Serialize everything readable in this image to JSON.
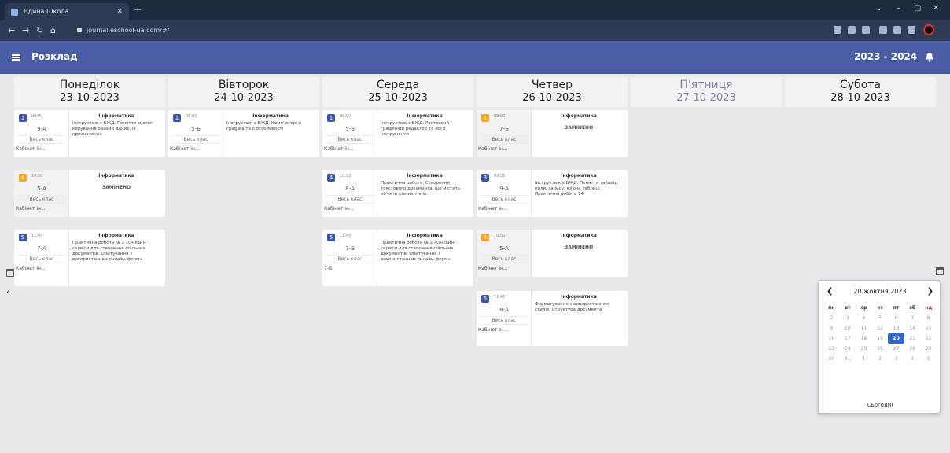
{
  "browser": {
    "tab_title": "Єдина Школа",
    "url": "journal.eschool-ua.com/#/",
    "window_controls": [
      "⌄",
      "–",
      "▢",
      "✕"
    ]
  },
  "app": {
    "title": "Розклад",
    "year": "2023 - 2024"
  },
  "days": [
    {
      "name": "Понеділок",
      "date": "23-10-2023"
    },
    {
      "name": "Вівторок",
      "date": "24-10-2023"
    },
    {
      "name": "Середа",
      "date": "25-10-2023"
    },
    {
      "name": "Четвер",
      "date": "26-10-2023"
    },
    {
      "name": "П'ятниця",
      "date": "27-10-2023"
    },
    {
      "name": "Субота",
      "date": "28-10-2023"
    }
  ],
  "lessons": [
    {
      "num": "1",
      "time": "08:00",
      "cls": "9-А",
      "group": "Весь клас",
      "room": "Кабінет ін...",
      "subject": "Інформатика",
      "topic": "Інструктаж з БЖД. Поняття систем керування базами даних, їх призначення"
    },
    {
      "num": "4",
      "time": "10:50",
      "cls": "5-А",
      "group": "Весь клас",
      "room": "Кабінет ін...",
      "subject": "Інформатика",
      "topic": "ЗАМІНЕНО"
    },
    {
      "num": "5",
      "time": "11:45",
      "cls": "7-А",
      "group": "Весь клас",
      "room": "Кабінет ін...",
      "subject": "Інформатика",
      "topic": "Практична робота № 2 «Онлайн-сервіси для створення спільних документів. Опитування з використанням онлайн-форм»"
    },
    {
      "num": "1",
      "time": "08:00",
      "cls": "5-Б",
      "group": "Весь клас",
      "room": "Кабінет ін...",
      "subject": "Інформатика",
      "topic": "Інструктаж з БЖД. Комп'ютерна графіка та її особливості"
    },
    {
      "num": "1",
      "time": "08:00",
      "cls": "5-Б",
      "group": "Весь клас",
      "room": "Кабінет ін...",
      "subject": "Інформатика",
      "topic": "Інструктаж з БЖД. Растровий графічний редактор та його інструменти"
    },
    {
      "num": "4",
      "time": "10:50",
      "cls": "8-А",
      "group": "Весь клас",
      "room": "Кабінет ін...",
      "subject": "Інформатика",
      "topic": "Практична робота. Створення текстового документа, що містить об'єкти різних типів."
    },
    {
      "num": "5",
      "time": "11:45",
      "cls": "7-Б",
      "group": "Весь клас",
      "room": "7-Б",
      "subject": "Інформатика",
      "topic": "Практична робота № 2 «Онлайн-сервіси для створення спільних документів. Опитування з використанням онлайн-форм»"
    },
    {
      "num": "1",
      "time": "08:00",
      "cls": "7-Б",
      "group": "Весь клас",
      "room": "Кабінет ін...",
      "subject": "Інформатика",
      "topic": "ЗАМІНЕНО"
    },
    {
      "num": "3",
      "time": "09:55",
      "cls": "9-А",
      "group": "Весь клас",
      "room": "Кабінет ін...",
      "subject": "Інформатика",
      "topic": "Інструктаж з БЖД. Поняття таблиці, поля, запису, ключа таблиці. Практична робота 14"
    },
    {
      "num": "4",
      "time": "10:50",
      "cls": "5-А",
      "group": "Весь клас",
      "room": "Кабінет ін...",
      "subject": "Інформатика",
      "topic": "ЗАМІНЕНО"
    },
    {
      "num": "5",
      "time": "11:45",
      "cls": "8-А",
      "group": "Весь клас",
      "room": "Кабінет ін...",
      "subject": "Інформатика",
      "topic": "Форматування з використанням стилів. Структура документа"
    }
  ],
  "picker": {
    "title": "20 жовтня 2023",
    "weekdays": [
      "пн",
      "вт",
      "ср",
      "чт",
      "пт",
      "сб",
      "нд"
    ],
    "weeks": [
      [
        "2",
        "3",
        "4",
        "5",
        "6",
        "7",
        "8"
      ],
      [
        "9",
        "10",
        "11",
        "12",
        "13",
        "14",
        "15"
      ],
      [
        "16",
        "17",
        "18",
        "19",
        "20",
        "21",
        "22"
      ],
      [
        "23",
        "24",
        "25",
        "26",
        "27",
        "28",
        "29"
      ],
      [
        "30",
        "31",
        "1",
        "2",
        "3",
        "4",
        "5"
      ]
    ],
    "today_label": "Сьогодні"
  },
  "colors": {
    "accent": "#4a5ca3",
    "replaced": "#f5a623",
    "lesson_num": "#3e56a8",
    "selected_day": "#3168c7"
  }
}
